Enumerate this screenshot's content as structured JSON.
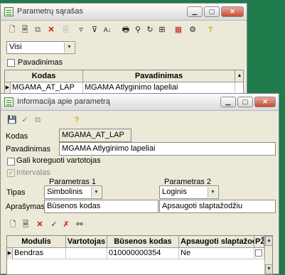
{
  "list_window": {
    "title": "Parametrų sąrašas",
    "filter": {
      "selected": "Visi"
    },
    "pavadinimas_checkbox_label": "Pavadinimas",
    "columns": [
      "Kodas",
      "Pavadinimas"
    ],
    "rows": [
      {
        "kodas": "MGAMA_AT_LAP",
        "pavadinimas": "MGAMA Atlyginimo lapeliai"
      }
    ]
  },
  "info_window": {
    "title": "Informacija apie parametrą",
    "kodas_label": "Kodas",
    "kodas_value": "MGAMA_AT_LAP",
    "pavadinimas_label": "Pavadinimas",
    "pavadinimas_value": "MGAMA Atlyginimo lapeliai",
    "gali_koreguoti_label": "Gali koreguoti vartotojas",
    "intervalas_label": "Intervalas",
    "parametras1_label": "Parametras 1",
    "parametras2_label": "Parametras 2",
    "tipas_label": "Tipas",
    "tipas1_value": "Simbolinis",
    "tipas2_value": "Loginis",
    "aprasymas_label": "Aprašymas",
    "aprasymas1_value": "Būsenos kodas",
    "aprasymas2_value": "Apsaugoti slaptažodžiu",
    "columns": [
      "Modulis",
      "Vartotojas",
      "Būsenos kodas",
      "Apsaugoti slaptažodžiu",
      "PŽ"
    ],
    "rows": [
      {
        "modulis": "Bendras",
        "vartotojas": "",
        "busenos_kodas": "010000000354",
        "apsaugoti": "Ne"
      }
    ]
  },
  "icons": [
    "new-icon",
    "edit-icon",
    "copy-icon",
    "delete-icon",
    "filter-icon",
    "sort-icon",
    "print-icon",
    "find-icon",
    "refresh-icon",
    "tree-icon",
    "grid-icon",
    "settings-icon",
    "help-icon",
    "save-icon",
    "checkmark-icon",
    "binoculars-icon"
  ],
  "colors": {
    "desktop": "#1f7a4c",
    "window": "#ece9d8",
    "close_button": "#c94c35",
    "help_icon": "#d4b000",
    "delete_icon": "#cc1010"
  }
}
